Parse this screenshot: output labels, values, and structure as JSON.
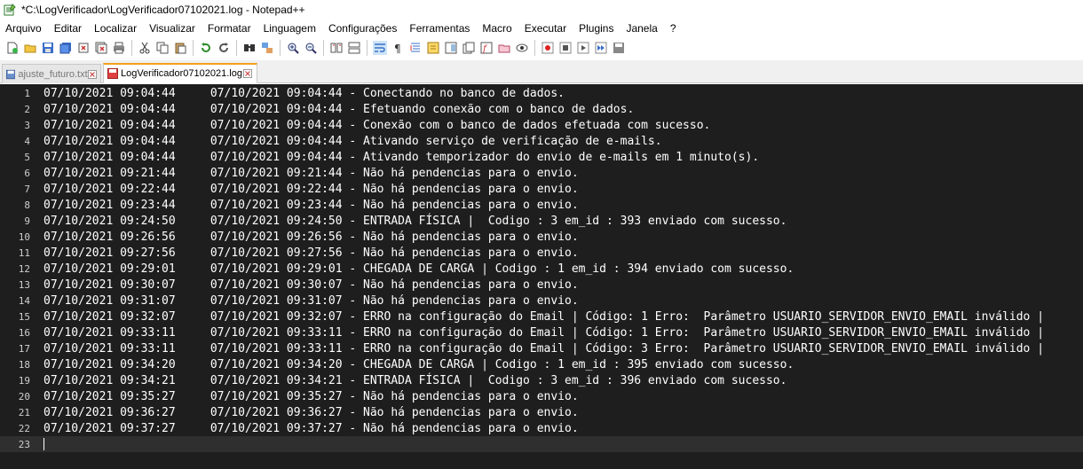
{
  "window": {
    "title": "*C:\\LogVerificador\\LogVerificador07102021.log - Notepad++"
  },
  "menu": [
    {
      "label": "Arquivo"
    },
    {
      "label": "Editar"
    },
    {
      "label": "Localizar"
    },
    {
      "label": "Visualizar"
    },
    {
      "label": "Formatar"
    },
    {
      "label": "Linguagem"
    },
    {
      "label": "Configurações"
    },
    {
      "label": "Ferramentas"
    },
    {
      "label": "Macro"
    },
    {
      "label": "Executar"
    },
    {
      "label": "Plugins"
    },
    {
      "label": "Janela"
    },
    {
      "label": "?"
    }
  ],
  "tabs": [
    {
      "label": "ajuste_futuro.txt",
      "active": false
    },
    {
      "label": "LogVerificador07102021.log",
      "active": true
    }
  ],
  "editor": {
    "lines": [
      {
        "n": "1",
        "text": "07/10/2021 09:04:44     07/10/2021 09:04:44 - Conectando no banco de dados."
      },
      {
        "n": "2",
        "text": "07/10/2021 09:04:44     07/10/2021 09:04:44 - Efetuando conexão com o banco de dados."
      },
      {
        "n": "3",
        "text": "07/10/2021 09:04:44     07/10/2021 09:04:44 - Conexão com o banco de dados efetuada com sucesso."
      },
      {
        "n": "4",
        "text": "07/10/2021 09:04:44     07/10/2021 09:04:44 - Ativando serviço de verificação de e-mails."
      },
      {
        "n": "5",
        "text": "07/10/2021 09:04:44     07/10/2021 09:04:44 - Ativando temporizador do envio de e-mails em 1 minuto(s)."
      },
      {
        "n": "6",
        "text": "07/10/2021 09:21:44     07/10/2021 09:21:44 - Não há pendencias para o envio."
      },
      {
        "n": "7",
        "text": "07/10/2021 09:22:44     07/10/2021 09:22:44 - Não há pendencias para o envio."
      },
      {
        "n": "8",
        "text": "07/10/2021 09:23:44     07/10/2021 09:23:44 - Não há pendencias para o envio."
      },
      {
        "n": "9",
        "text": "07/10/2021 09:24:50     07/10/2021 09:24:50 - ENTRADA FÍSICA |  Codigo : 3 em_id : 393 enviado com sucesso."
      },
      {
        "n": "10",
        "text": "07/10/2021 09:26:56     07/10/2021 09:26:56 - Não há pendencias para o envio."
      },
      {
        "n": "11",
        "text": "07/10/2021 09:27:56     07/10/2021 09:27:56 - Não há pendencias para o envio."
      },
      {
        "n": "12",
        "text": "07/10/2021 09:29:01     07/10/2021 09:29:01 - CHEGADA DE CARGA | Codigo : 1 em_id : 394 enviado com sucesso."
      },
      {
        "n": "13",
        "text": "07/10/2021 09:30:07     07/10/2021 09:30:07 - Não há pendencias para o envio."
      },
      {
        "n": "14",
        "text": "07/10/2021 09:31:07     07/10/2021 09:31:07 - Não há pendencias para o envio."
      },
      {
        "n": "15",
        "text": "07/10/2021 09:32:07     07/10/2021 09:32:07 - ERRO na configuração do Email | Código: 1 Erro:  Parâmetro USUARIO_SERVIDOR_ENVIO_EMAIL inválido |"
      },
      {
        "n": "16",
        "text": "07/10/2021 09:33:11     07/10/2021 09:33:11 - ERRO na configuração do Email | Código: 1 Erro:  Parâmetro USUARIO_SERVIDOR_ENVIO_EMAIL inválido |"
      },
      {
        "n": "17",
        "text": "07/10/2021 09:33:11     07/10/2021 09:33:11 - ERRO na configuração do Email | Código: 3 Erro:  Parâmetro USUARIO_SERVIDOR_ENVIO_EMAIL inválido |"
      },
      {
        "n": "18",
        "text": "07/10/2021 09:34:20     07/10/2021 09:34:20 - CHEGADA DE CARGA | Codigo : 1 em_id : 395 enviado com sucesso."
      },
      {
        "n": "19",
        "text": "07/10/2021 09:34:21     07/10/2021 09:34:21 - ENTRADA FÍSICA |  Codigo : 3 em_id : 396 enviado com sucesso."
      },
      {
        "n": "20",
        "text": "07/10/2021 09:35:27     07/10/2021 09:35:27 - Não há pendencias para o envio."
      },
      {
        "n": "21",
        "text": "07/10/2021 09:36:27     07/10/2021 09:36:27 - Não há pendencias para o envio."
      },
      {
        "n": "22",
        "text": "07/10/2021 09:37:27     07/10/2021 09:37:27 - Não há pendencias para o envio."
      },
      {
        "n": "23",
        "text": ""
      }
    ]
  },
  "colors": {
    "editor_bg": "#1e1e1e",
    "current_line": "#2f2f2f",
    "active_tab_accent": "#f4a020"
  }
}
